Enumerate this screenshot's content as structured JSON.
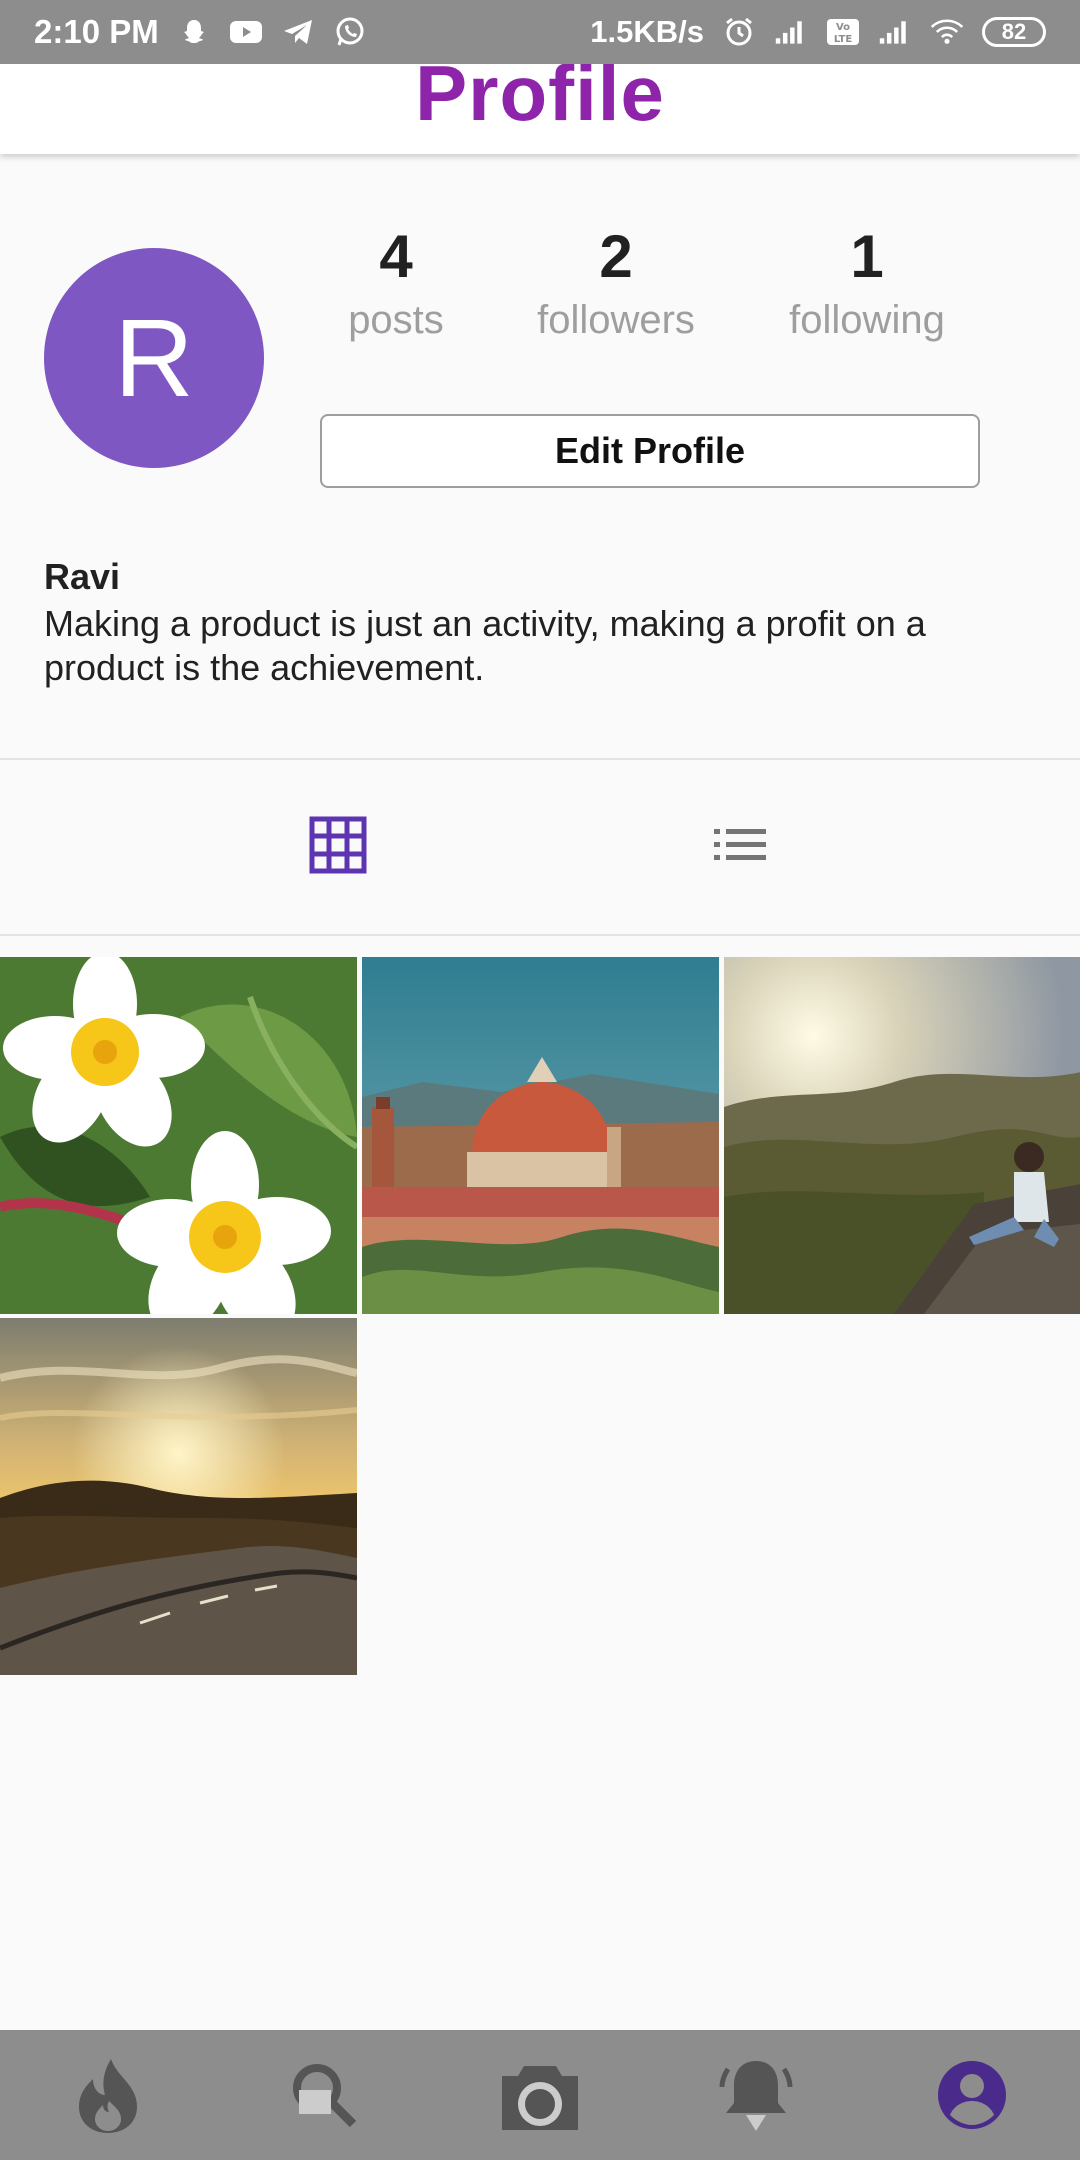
{
  "status_bar": {
    "time": "2:10 PM",
    "net_speed": "1.5KB/s",
    "battery": "82",
    "left_icons": [
      "snapchat-icon",
      "youtube-icon",
      "telegram-icon",
      "whatsapp-icon"
    ],
    "right_icons": [
      "alarm-icon",
      "signal-icon",
      "volte-icon",
      "signal-icon",
      "wifi-icon",
      "battery-icon"
    ]
  },
  "app_bar": {
    "title": "Profile",
    "title_color": "#8e24aa"
  },
  "profile": {
    "avatar_letter": "R",
    "avatar_color": "#7e57c2",
    "name": "Ravi",
    "bio": "Making a product is just an activity, making a profit on a product is the achievement."
  },
  "stats": [
    {
      "value": "4",
      "label": "posts"
    },
    {
      "value": "2",
      "label": "followers"
    },
    {
      "value": "1",
      "label": "following"
    }
  ],
  "edit_button": {
    "label": "Edit Profile"
  },
  "view_tabs": [
    {
      "icon": "grid-icon",
      "active": true,
      "color": "#5e35b1"
    },
    {
      "icon": "list-icon",
      "active": false,
      "color": "#757575"
    }
  ],
  "posts": [
    {
      "subject": "frangipani-flowers"
    },
    {
      "subject": "florence-cathedral"
    },
    {
      "subject": "person-on-mountain"
    },
    {
      "subject": "sunset-road"
    }
  ],
  "bottom_nav": [
    {
      "icon": "fire-icon",
      "active": false
    },
    {
      "icon": "search-icon",
      "active": false
    },
    {
      "icon": "camera-icon",
      "active": false
    },
    {
      "icon": "notification-bell-icon",
      "active": false
    },
    {
      "icon": "profile-icon",
      "active": true,
      "color": "#4a2a8a"
    }
  ]
}
